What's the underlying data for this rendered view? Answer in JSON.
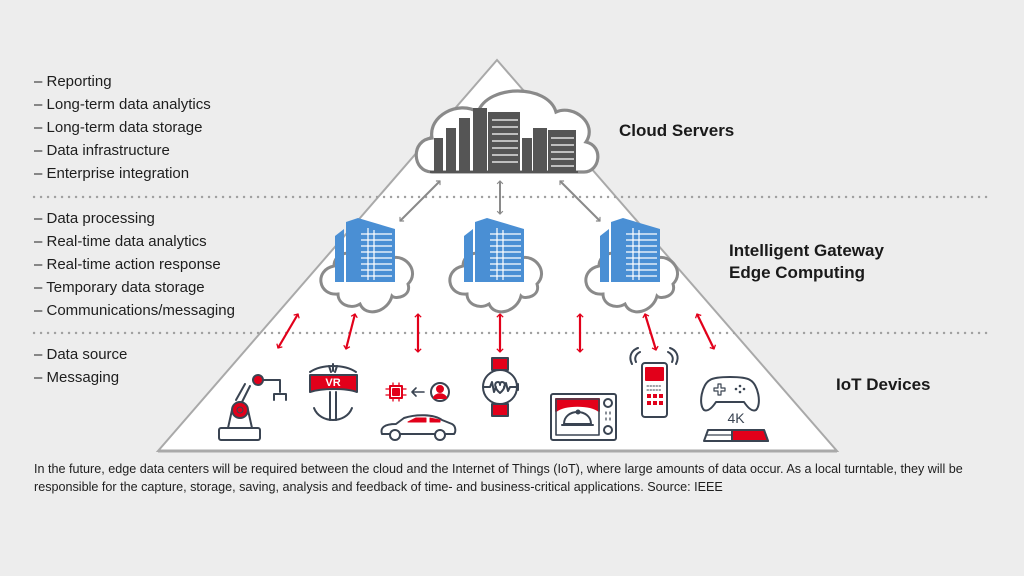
{
  "colors": {
    "background": "#ededed",
    "triangle_fill": "#ffffff",
    "triangle_stroke": "#a9a9a9",
    "cloud_building": "#555555",
    "edge_building": "#4a8fd4",
    "cloud_outline": "#8a8a8a",
    "gray_arrow": "#8a8a8a",
    "red_arrow": "#e2001a",
    "device_outline": "#3a4452",
    "device_accent": "#e2001a",
    "dotted_line": "#a0a0a0"
  },
  "tiers": [
    {
      "id": "cloud",
      "label": "Cloud Servers",
      "functions": [
        "– Reporting",
        "– Long-term data analytics",
        "– Long-term data storage",
        "– Data infrastructure",
        "– Enterprise integration"
      ]
    },
    {
      "id": "edge",
      "label_line1": "Intelligent Gateway",
      "label_line2": "Edge Computing",
      "functions": [
        "– Data processing",
        "– Real-time data analytics",
        "– Real-time action response",
        "– Temporary data storage",
        "– Communications/messaging"
      ]
    },
    {
      "id": "iot",
      "label": "IoT Devices",
      "functions": [
        "– Data source",
        "– Messaging"
      ]
    }
  ],
  "icons": {
    "cloud_server": "cloud-datacenter-icon",
    "edge_nodes": [
      "edge-datacenter-icon",
      "edge-datacenter-icon",
      "edge-datacenter-icon"
    ],
    "devices": [
      "industrial-robot-arm-icon",
      "vr-headset-icon",
      "connected-car-icon",
      "smartwatch-icon",
      "smart-oven-icon",
      "mobile-phone-icon",
      "game-console-icon"
    ]
  },
  "device_text": {
    "vr": "VR",
    "console": "4K"
  },
  "caption": "In the future, edge data centers will be required between the cloud and the Internet of Things (IoT), where large amounts of data occur. As a local turntable, they will be responsible for the capture, storage, saving, analysis and feedback of time- and business-critical applications. Source: IEEE"
}
